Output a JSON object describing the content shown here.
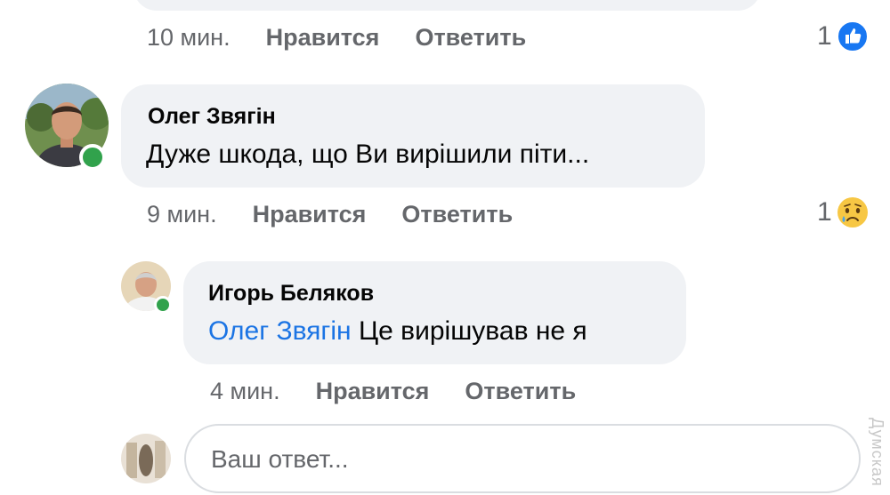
{
  "comments": [
    {
      "time": "10 мин.",
      "like_label": "Нравится",
      "reply_label": "Ответить",
      "reaction_count": "1",
      "reaction": "like-icon"
    },
    {
      "author": "Олег Звягін",
      "text": "Дуже шкода, що Ви вирішили піти...",
      "time": "9 мин.",
      "like_label": "Нравится",
      "reply_label": "Ответить",
      "reaction_count": "1",
      "reaction": "sad-face-icon"
    },
    {
      "author": "Игорь Беляков",
      "mention": "Олег Звягін",
      "text": "Це вирішував не я",
      "time": "4 мин.",
      "like_label": "Нравится",
      "reply_label": "Ответить"
    }
  ],
  "reply_box": {
    "placeholder": "Ваш ответ..."
  },
  "watermark": "Думская",
  "colors": {
    "accent": "#1b74e4",
    "bubble": "#f0f2f5",
    "online": "#31a24c",
    "meta": "#65676b"
  }
}
